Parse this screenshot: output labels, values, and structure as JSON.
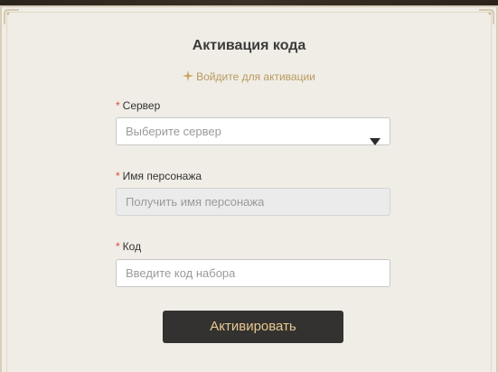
{
  "form": {
    "title": "Активация кода",
    "login_hint": "Войдите для активации",
    "required_mark": "*",
    "server": {
      "label": "Сервер",
      "placeholder": "Выберите сервер"
    },
    "character": {
      "label": "Имя персонажа",
      "placeholder": "Получить имя персонажа"
    },
    "code": {
      "label": "Код",
      "placeholder": "Введите код набора"
    },
    "submit_label": "Активировать"
  },
  "colors": {
    "panel_bg": "#f0ede6",
    "accent_gold": "#b89a5f",
    "button_bg": "#333230",
    "button_text": "#e7c88f",
    "required_red": "#d94a3a"
  },
  "icons": {
    "hint_icon": "sparkle-icon",
    "select_icon": "caret-down-icon"
  }
}
